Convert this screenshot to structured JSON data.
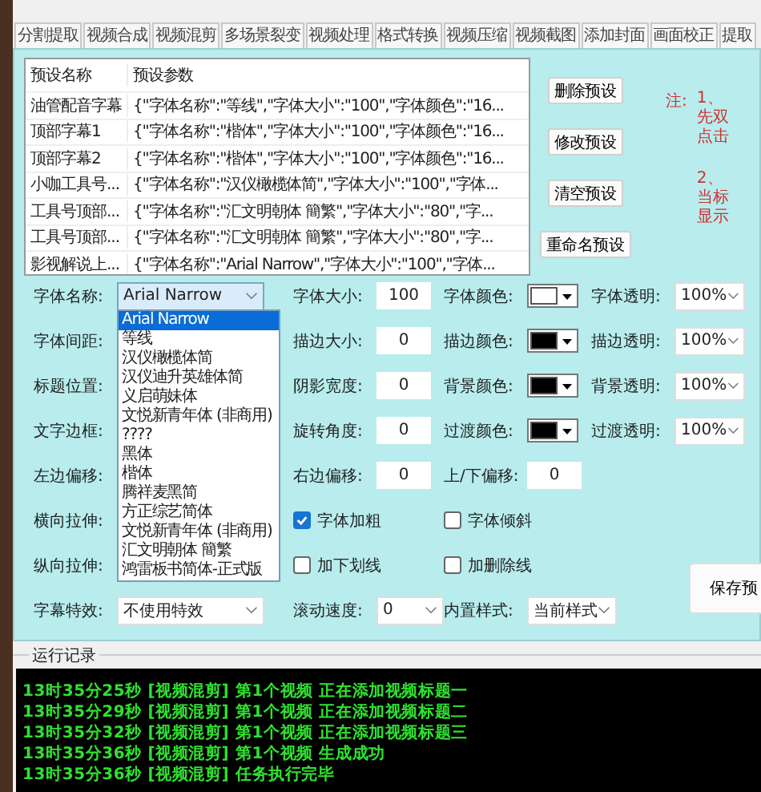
{
  "tabs": [
    {
      "label": "分割提取",
      "selected": false
    },
    {
      "label": "视频合成",
      "selected": false
    },
    {
      "label": "视频混剪",
      "selected": false
    },
    {
      "label": "多场景裂变",
      "selected": false
    },
    {
      "label": "视频处理",
      "selected": false
    },
    {
      "label": "格式转换",
      "selected": false
    },
    {
      "label": "视频压缩",
      "selected": false
    },
    {
      "label": "视频截图",
      "selected": false
    },
    {
      "label": "添加封面",
      "selected": false
    },
    {
      "label": "画面校正",
      "selected": false
    },
    {
      "label": "提取",
      "selected": false
    }
  ],
  "presets": {
    "columns": [
      "预设名称",
      "预设参数"
    ],
    "rows": [
      {
        "name": "油管配音字幕",
        "params": "{\"字体名称\":\"等线\",\"字体大小\":\"100\",\"字体颜色\":\"16..."
      },
      {
        "name": "顶部字幕1",
        "params": "{\"字体名称\":\"楷体\",\"字体大小\":\"100\",\"字体颜色\":\"16..."
      },
      {
        "name": "顶部字幕2",
        "params": "{\"字体名称\":\"楷体\",\"字体大小\":\"100\",\"字体颜色\":\"16..."
      },
      {
        "name": "小咖工具号...",
        "params": "{\"字体名称\":\"汉仪橄榄体简\",\"字体大小\":\"100\",\"字体..."
      },
      {
        "name": "工具号顶部...",
        "params": "{\"字体名称\":\"汇文明朝体 簡繁\",\"字体大小\":\"80\",\"字..."
      },
      {
        "name": "工具号顶部...",
        "params": "{\"字体名称\":\"汇文明朝体 簡繁\",\"字体大小\":\"80\",\"字..."
      },
      {
        "name": "影视解说上...",
        "params": "{\"字体名称\":\"Arial Narrow\",\"字体大小\":\"100\",\"字体..."
      }
    ]
  },
  "preset_buttons": [
    "删除预设",
    "修改预设",
    "清空预设",
    "重命名预设"
  ],
  "note": {
    "label": "注:",
    "lines": [
      "1、",
      "先双",
      "点击",
      "2、",
      "当标",
      "显示"
    ]
  },
  "form_rows": [
    [
      {
        "kind": "select",
        "label": "字体名称:",
        "value": "Arial Narrow",
        "expanded": true
      },
      {
        "kind": "number",
        "label": "字体大小:",
        "value": "100"
      },
      {
        "kind": "color",
        "label": "字体颜色:",
        "color": "#ffffff"
      },
      {
        "kind": "select",
        "label": "字体透明:",
        "value": "100%",
        "expanded": false
      }
    ],
    [
      {
        "kind": "covered",
        "label": "字体间距:"
      },
      {
        "kind": "number",
        "label": "描边大小:",
        "value": "0"
      },
      {
        "kind": "color",
        "label": "描边颜色:",
        "color": "#000000"
      },
      {
        "kind": "select",
        "label": "描边透明:",
        "value": "100%",
        "expanded": false
      }
    ],
    [
      {
        "kind": "covered",
        "label": "标题位置:"
      },
      {
        "kind": "number",
        "label": "阴影宽度:",
        "value": "0"
      },
      {
        "kind": "color",
        "label": "背景颜色:",
        "color": "#000000"
      },
      {
        "kind": "select",
        "label": "背景透明:",
        "value": "100%",
        "expanded": false
      }
    ],
    [
      {
        "kind": "covered",
        "label": "文字边框:"
      },
      {
        "kind": "number",
        "label": "旋转角度:",
        "value": "0"
      },
      {
        "kind": "color",
        "label": "过渡颜色:",
        "color": "#000000"
      },
      {
        "kind": "select",
        "label": "过渡透明:",
        "value": "100%",
        "expanded": false
      }
    ],
    [
      {
        "kind": "covered",
        "label": "左边偏移:"
      },
      {
        "kind": "number",
        "label": "右边偏移:",
        "value": "0"
      },
      {
        "kind": "number",
        "label": "上/下偏移:",
        "value": "0"
      }
    ],
    [
      {
        "kind": "covered",
        "label": "横向拉伸:"
      },
      {
        "kind": "checkbox",
        "label": "字体加粗",
        "checked": true
      },
      {
        "kind": "checkbox",
        "label": "字体倾斜",
        "checked": false
      }
    ],
    [
      {
        "kind": "covered",
        "label": "纵向拉伸:"
      },
      {
        "kind": "checkbox",
        "label": "加下划线",
        "checked": false
      },
      {
        "kind": "checkbox",
        "label": "加删除线",
        "checked": false
      }
    ],
    [
      {
        "kind": "select",
        "label": "字幕特效:",
        "value": "不使用特效",
        "expanded": false
      },
      {
        "kind": "select",
        "label": "滚动速度:",
        "value": "0",
        "expanded": false
      },
      {
        "kind": "select",
        "label": "内置样式:",
        "value": "当前样式",
        "expanded": false
      }
    ]
  ],
  "font_options": [
    {
      "label": "Arial Narrow",
      "selected": true
    },
    {
      "label": "等线",
      "selected": false
    },
    {
      "label": "汉仪橄榄体简",
      "selected": false
    },
    {
      "label": "汉仪迪升英雄体简",
      "selected": false
    },
    {
      "label": "义启萌妹体",
      "selected": false
    },
    {
      "label": "文悦新青年体 (非商用)",
      "selected": false
    },
    {
      "label": "????",
      "selected": false
    },
    {
      "label": "黑体",
      "selected": false
    },
    {
      "label": "楷体",
      "selected": false
    },
    {
      "label": "腾祥麦黑简",
      "selected": false
    },
    {
      "label": "方正综艺简体",
      "selected": false
    },
    {
      "label": "文悦新青年体 (非商用)",
      "selected": false
    },
    {
      "label": "汇文明朝体 簡繁",
      "selected": false
    },
    {
      "label": "鸿雷板书简体-正式版",
      "selected": false
    }
  ],
  "save_button": "保存预",
  "log": {
    "title": "运行记录",
    "lines": [
      "13时35分25秒 [视频混剪] 第1个视频 正在添加视频标题一",
      "13时35分29秒 [视频混剪] 第1个视频 正在添加视频标题二",
      "13时35分32秒 [视频混剪] 第1个视频 正在添加视频标题三",
      "13时35分36秒 [视频混剪] 第1个视频 生成成功",
      "13时35分36秒 [视频混剪] 任务执行完毕"
    ]
  }
}
